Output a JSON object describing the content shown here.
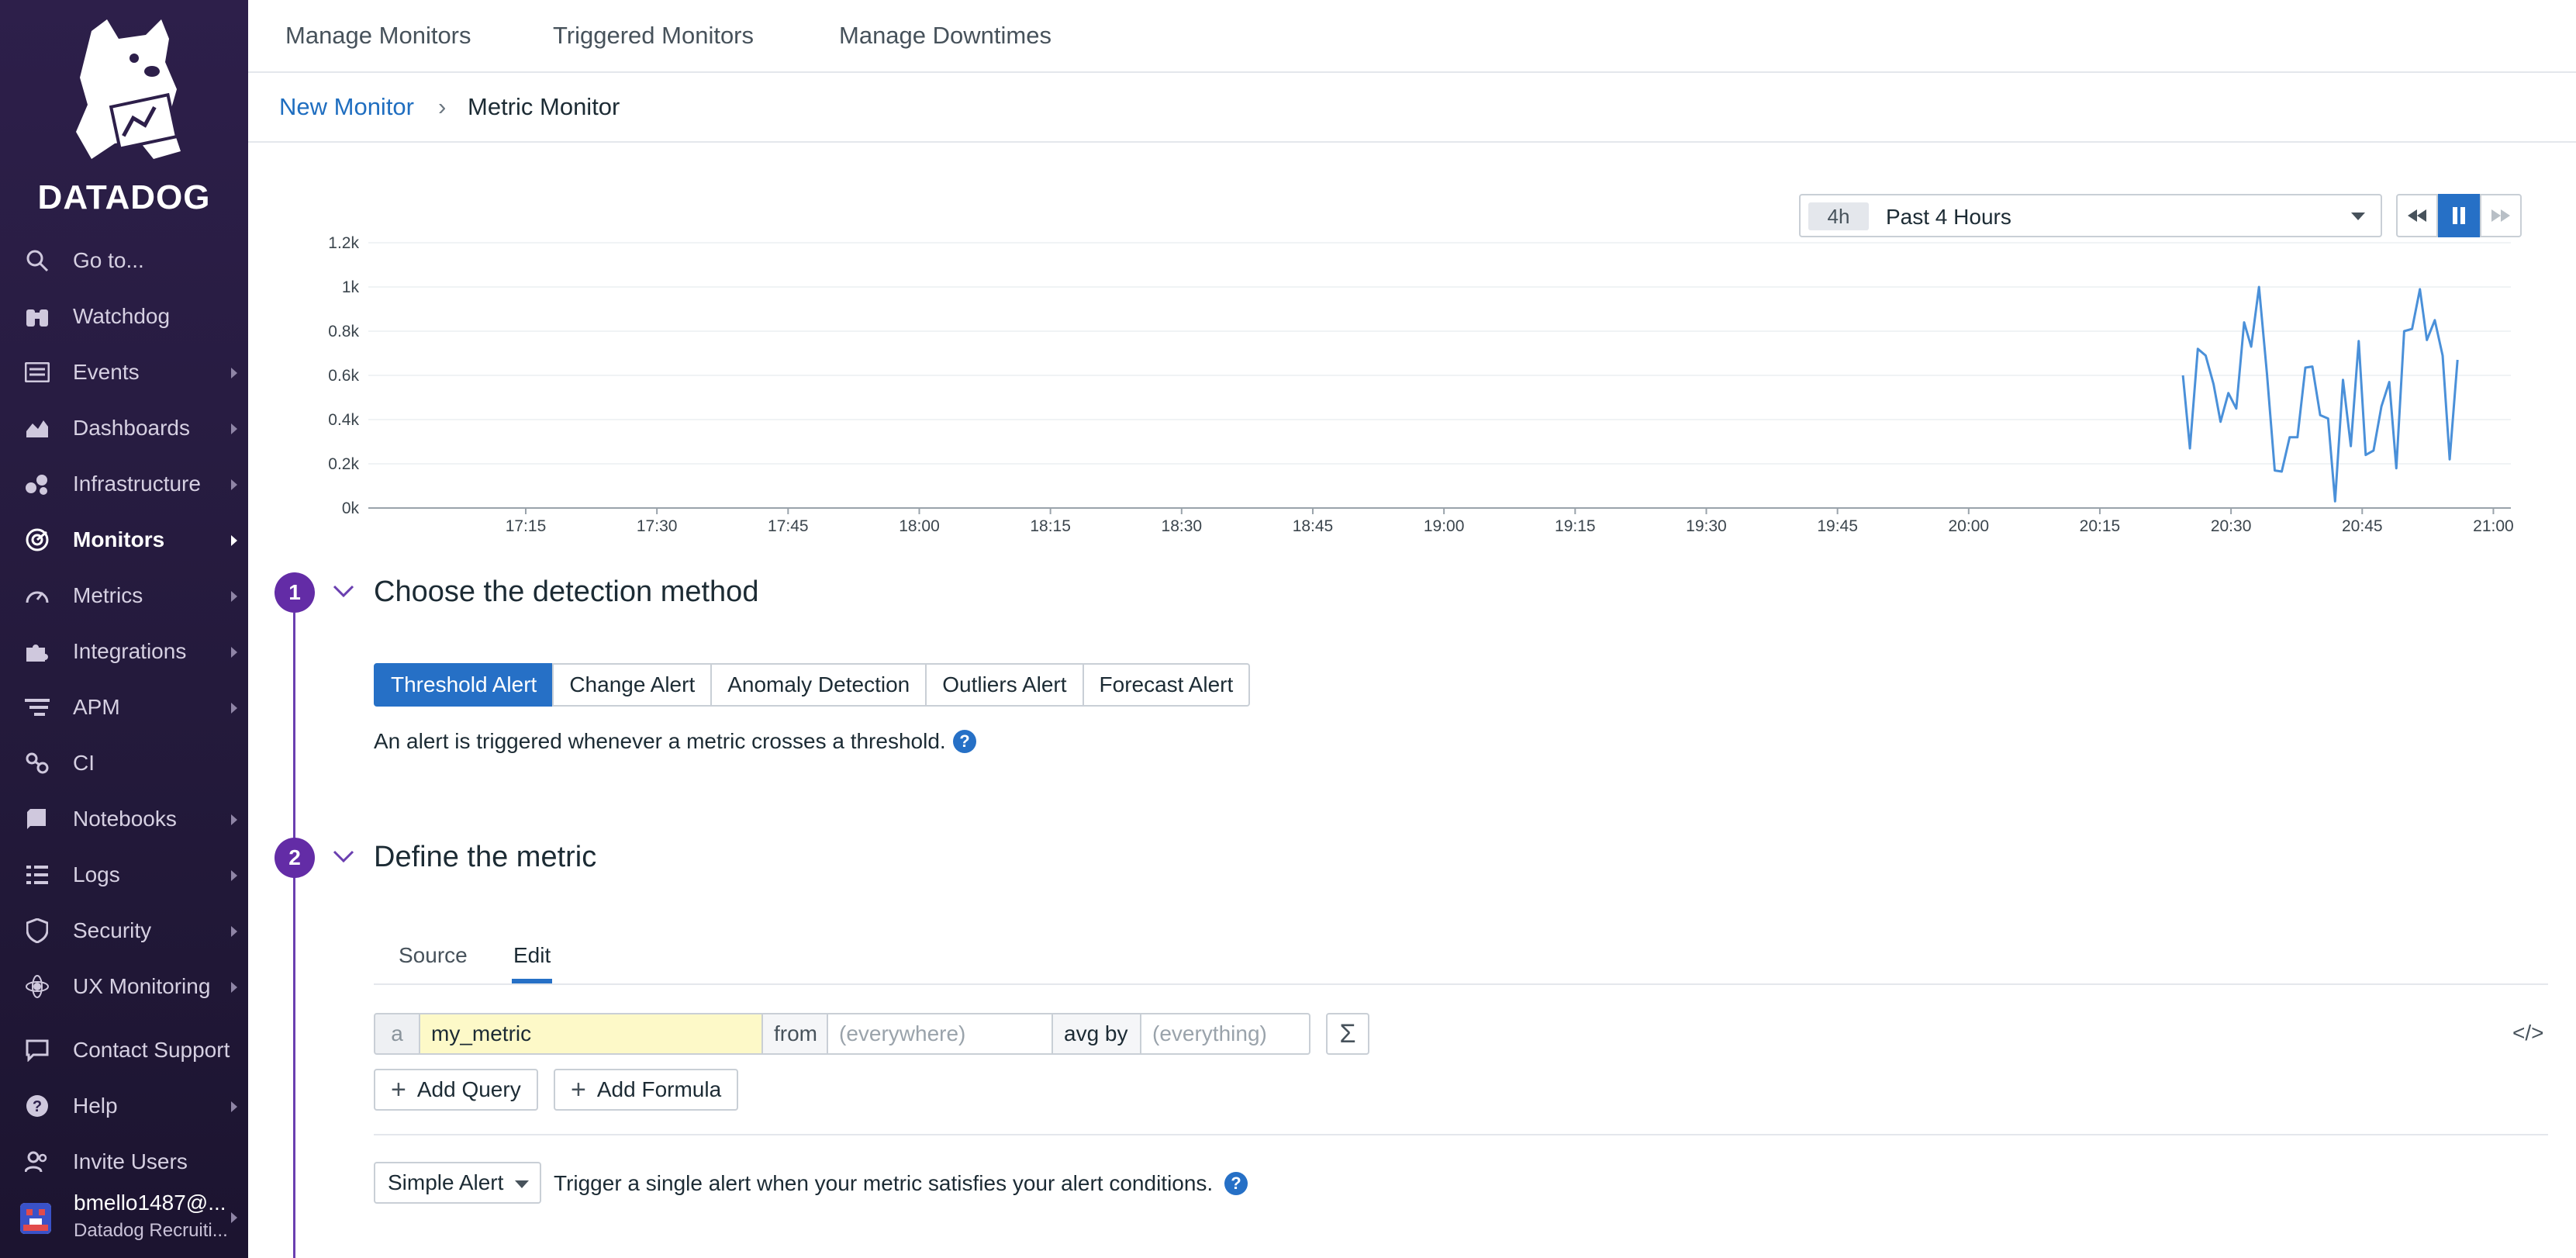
{
  "brand": {
    "name": "DATADOG"
  },
  "sidebar": {
    "items": [
      {
        "label": "Go to...",
        "icon": "search-icon"
      },
      {
        "label": "Watchdog",
        "icon": "binoculars-icon"
      },
      {
        "label": "Events",
        "icon": "list-icon"
      },
      {
        "label": "Dashboards",
        "icon": "area-chart-icon"
      },
      {
        "label": "Infrastructure",
        "icon": "hexagon-nodes-icon"
      },
      {
        "label": "Monitors",
        "icon": "radar-icon",
        "active": true
      },
      {
        "label": "Metrics",
        "icon": "gauge-icon"
      },
      {
        "label": "Integrations",
        "icon": "puzzle-icon"
      },
      {
        "label": "APM",
        "icon": "bars-icon"
      },
      {
        "label": "CI",
        "icon": "link-icon"
      },
      {
        "label": "Notebooks",
        "icon": "notebook-icon"
      },
      {
        "label": "Logs",
        "icon": "logs-icon"
      },
      {
        "label": "Security",
        "icon": "shield-icon"
      },
      {
        "label": "UX Monitoring",
        "icon": "atom-icon"
      },
      {
        "label": "Contact Support",
        "icon": "chat-icon"
      },
      {
        "label": "Help",
        "icon": "question-icon"
      },
      {
        "label": "Invite Users",
        "icon": "users-icon"
      }
    ],
    "user": {
      "name": "bmello1487@...",
      "org": "Datadog Recruiti..."
    }
  },
  "topnav": {
    "items": [
      "Manage Monitors",
      "Triggered Monitors",
      "Manage Downtimes"
    ]
  },
  "breadcrumb": {
    "parent": "New Monitor",
    "separator": "›",
    "current": "Metric Monitor"
  },
  "timeframe": {
    "badge": "4h",
    "label": "Past 4 Hours"
  },
  "chart_data": {
    "type": "line",
    "ylim": [
      0,
      1200
    ],
    "yticks": [
      {
        "v": 0,
        "label": "0k"
      },
      {
        "v": 200,
        "label": "0.2k"
      },
      {
        "v": 400,
        "label": "0.4k"
      },
      {
        "v": 600,
        "label": "0.6k"
      },
      {
        "v": 800,
        "label": "0.8k"
      },
      {
        "v": 1000,
        "label": "1k"
      },
      {
        "v": 1200,
        "label": "1.2k"
      }
    ],
    "xlim_minutes": [
      1017,
      1262
    ],
    "xticks": [
      {
        "m": 1035,
        "label": "17:15"
      },
      {
        "m": 1050,
        "label": "17:30"
      },
      {
        "m": 1065,
        "label": "17:45"
      },
      {
        "m": 1080,
        "label": "18:00"
      },
      {
        "m": 1095,
        "label": "18:15"
      },
      {
        "m": 1110,
        "label": "18:30"
      },
      {
        "m": 1125,
        "label": "18:45"
      },
      {
        "m": 1140,
        "label": "19:00"
      },
      {
        "m": 1155,
        "label": "19:15"
      },
      {
        "m": 1170,
        "label": "19:30"
      },
      {
        "m": 1185,
        "label": "19:45"
      },
      {
        "m": 1200,
        "label": "20:00"
      },
      {
        "m": 1215,
        "label": "20:15"
      },
      {
        "m": 1230,
        "label": "20:30"
      },
      {
        "m": 1245,
        "label": "20:45"
      },
      {
        "m": 1260,
        "label": "21:00"
      }
    ],
    "series": [
      {
        "color": "#4a90d9",
        "points": [
          [
            1224.5,
            600
          ],
          [
            1225.3,
            270
          ],
          [
            1226.2,
            720
          ],
          [
            1227.1,
            690
          ],
          [
            1228.0,
            560
          ],
          [
            1228.8,
            390
          ],
          [
            1229.7,
            520
          ],
          [
            1230.6,
            450
          ],
          [
            1231.5,
            840
          ],
          [
            1232.3,
            730
          ],
          [
            1233.2,
            1000
          ],
          [
            1234.1,
            610
          ],
          [
            1235.0,
            170
          ],
          [
            1235.8,
            165
          ],
          [
            1236.7,
            320
          ],
          [
            1237.6,
            320
          ],
          [
            1238.5,
            635
          ],
          [
            1239.3,
            640
          ],
          [
            1240.2,
            420
          ],
          [
            1241.1,
            405
          ],
          [
            1241.9,
            30
          ],
          [
            1242.8,
            580
          ],
          [
            1243.7,
            280
          ],
          [
            1244.6,
            755
          ],
          [
            1245.4,
            240
          ],
          [
            1246.3,
            260
          ],
          [
            1247.2,
            460
          ],
          [
            1248.1,
            570
          ],
          [
            1248.9,
            180
          ],
          [
            1249.8,
            800
          ],
          [
            1250.7,
            810
          ],
          [
            1251.6,
            990
          ],
          [
            1252.4,
            760
          ],
          [
            1253.3,
            850
          ],
          [
            1254.2,
            690
          ],
          [
            1255.0,
            220
          ],
          [
            1255.9,
            670
          ]
        ]
      }
    ]
  },
  "steps": [
    {
      "number": "1",
      "title": "Choose the detection method"
    },
    {
      "number": "2",
      "title": "Define the metric"
    }
  ],
  "detection": {
    "options": [
      "Threshold Alert",
      "Change Alert",
      "Anomaly Detection",
      "Outliers Alert",
      "Forecast Alert"
    ],
    "selected": "Threshold Alert",
    "description": "An alert is triggered whenever a metric crosses a threshold."
  },
  "metric": {
    "tabs": [
      "Source",
      "Edit"
    ],
    "active_tab": "Edit",
    "query": {
      "letter": "a",
      "metric": "my_metric",
      "from_label": "from",
      "from_placeholder": "(everywhere)",
      "avg_label": "avg by",
      "avg_placeholder": "(everything)",
      "sigma": "Σ",
      "code": "</>"
    },
    "add_query": "Add Query",
    "add_formula": "Add Formula",
    "alert_type": "Simple Alert",
    "alert_desc": "Trigger a single alert when your metric satisfies your alert conditions."
  }
}
